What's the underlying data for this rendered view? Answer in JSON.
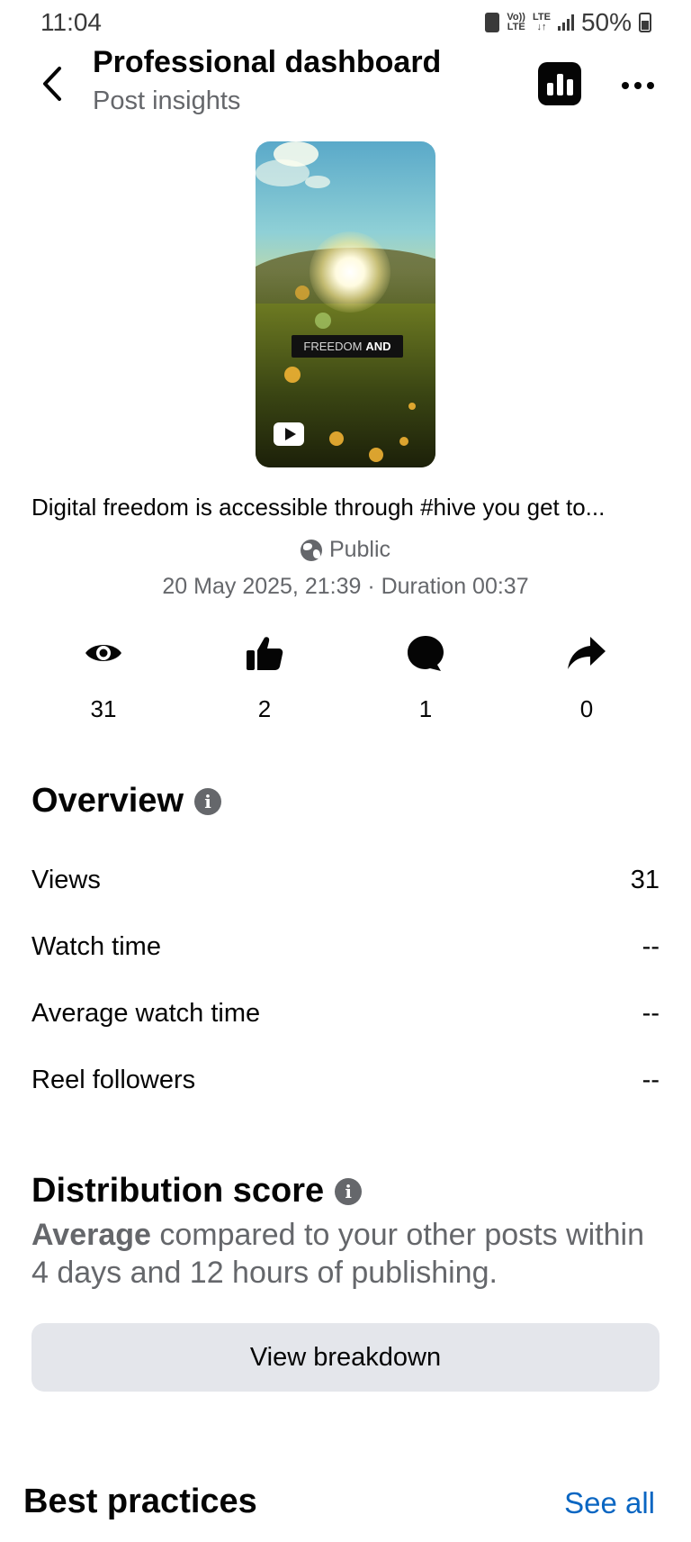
{
  "status_bar": {
    "time": "11:04",
    "net1_top": "Vo))",
    "net1_bottom": "LTE",
    "net2_top": "LTE",
    "net2_bottom": "↓↑",
    "battery": "50%"
  },
  "header": {
    "title": "Professional dashboard",
    "subtitle": "Post insights"
  },
  "post": {
    "thumbnail_caption_light": "FREEDOM",
    "thumbnail_caption_bold": "AND",
    "caption": "Digital freedom is accessible through #hive you get to...",
    "privacy": "Public",
    "date_duration": "20 May 2025, 21:39 · Duration 00:37"
  },
  "stats": [
    {
      "icon": "eye-icon",
      "value": "31"
    },
    {
      "icon": "thumbs-up-icon",
      "value": "2"
    },
    {
      "icon": "comment-icon",
      "value": "1"
    },
    {
      "icon": "share-icon",
      "value": "0"
    }
  ],
  "overview": {
    "title": "Overview",
    "rows": [
      {
        "label": "Views",
        "value": "31"
      },
      {
        "label": "Watch time",
        "value": "--"
      },
      {
        "label": "Average watch time",
        "value": "--"
      },
      {
        "label": "Reel followers",
        "value": "--"
      }
    ]
  },
  "distribution": {
    "title": "Distribution score",
    "score": "Average",
    "description": " compared to your other posts within 4 days and 12 hours of publishing.",
    "button": "View breakdown"
  },
  "best_practices": {
    "title": "Best practices",
    "see_all": "See all"
  },
  "colors": {
    "primary_text": "#050505",
    "secondary_text": "#65676b",
    "button_bg": "#e4e6eb",
    "link": "#0a66c2"
  }
}
